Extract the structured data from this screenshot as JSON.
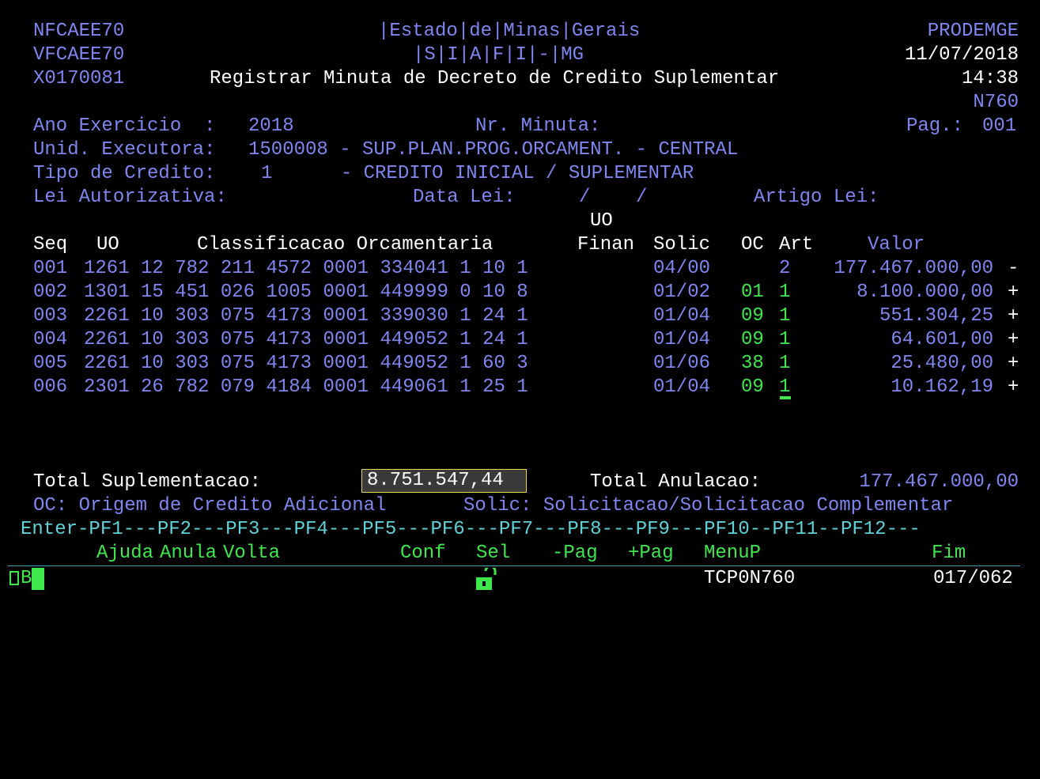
{
  "header": {
    "program_id": "NFCAEE70",
    "screen_id": "VFCAEE70",
    "transaction_id": "X0170081",
    "state_title": "|Estado|de|Minas|Gerais",
    "system_title": "|S|I|A|F|I|-|MG",
    "screen_title": "Registrar Minuta de Decreto de Credito Suplementar",
    "company": "PRODEMGE",
    "date": "11/07/2018",
    "time": "14:38",
    "screen_code": "N760"
  },
  "form": {
    "ano_label": "Ano Exercicio  :",
    "ano_value": "2018",
    "minuta_label": "Nr. Minuta:",
    "pag_label": "Pag.:",
    "pag_value": "001",
    "unid_label": "Unid. Executora:",
    "unid_value": "1500008 - SUP.PLAN.PROG.ORCAMENT. - CENTRAL",
    "tipo_label": "Tipo de Credito:",
    "tipo_value": "1      - CREDITO INICIAL / SUPLEMENTAR",
    "lei_label": "Lei Autorizativa:",
    "data_lei_label": "Data Lei:",
    "data_lei_value": "/    /",
    "artigo_label": "Artigo Lei:"
  },
  "table": {
    "headers": {
      "seq": "Seq",
      "uo": "UO",
      "classificacao": "Classificacao Orcamentaria",
      "uo_top": "UO",
      "finan": "Finan",
      "solic": "Solic",
      "oc": "OC",
      "art": "Art",
      "valor": "Valor"
    },
    "rows": [
      {
        "seq": "001",
        "classificacao": "1261 12 782 211 4572 0001 334041 1 10 1",
        "solic": "04/00",
        "oc": "",
        "art": "2",
        "valor": "177.467.000,00",
        "sign": "-"
      },
      {
        "seq": "002",
        "classificacao": "1301 15 451 026 1005 0001 449999 0 10 8",
        "solic": "01/02",
        "oc": "01",
        "art": "1",
        "valor": "8.100.000,00",
        "sign": "+"
      },
      {
        "seq": "003",
        "classificacao": "2261 10 303 075 4173 0001 339030 1 24 1",
        "solic": "01/04",
        "oc": "09",
        "art": "1",
        "valor": "551.304,25",
        "sign": "+"
      },
      {
        "seq": "004",
        "classificacao": "2261 10 303 075 4173 0001 449052 1 24 1",
        "solic": "01/04",
        "oc": "09",
        "art": "1",
        "valor": "64.601,00",
        "sign": "+"
      },
      {
        "seq": "005",
        "classificacao": "2261 10 303 075 4173 0001 449052 1 60 3",
        "solic": "01/06",
        "oc": "38",
        "art": "1",
        "valor": "25.480,00",
        "sign": "+"
      },
      {
        "seq": "006",
        "classificacao": "2301 26 782 079 4184 0001 449061 1 25 1",
        "solic": "01/04",
        "oc": "09",
        "art": "1",
        "valor": "10.162,19",
        "sign": "+"
      }
    ]
  },
  "totals": {
    "suplementacao_label": "Total Suplementacao:",
    "suplementacao_value": "8.751.547,44",
    "anulacao_label": "Total Anulacao:",
    "anulacao_value": "177.467.000,00"
  },
  "legend": {
    "oc": "OC: Origem de Credito Adicional",
    "solic": "Solic: Solicitacao/Solicitacao Complementar"
  },
  "function_keys": {
    "keys_line": "Enter-PF1---PF2---PF3---PF4---PF5---PF6---PF7---PF8---PF9---PF10--PF11--PF12---",
    "labels": {
      "pf1": "Ajuda",
      "pf2": "Anula",
      "pf3": "Volta",
      "pf5": "Conf",
      "pf6": "Sel",
      "pf7": "-Pag",
      "pf8": "+Pag",
      "pf9": "MenuP",
      "pf12": "Fim"
    }
  },
  "status_bar": {
    "session_letter": "B",
    "terminal_id": "TCP0N760",
    "cursor_pos": "017/062"
  },
  "colors": {
    "background": "#000000",
    "label": "#7f86f0",
    "value": "#ffffff",
    "highlight": "#3ee84c",
    "function_keys": "#5fd2d8",
    "field_border": "#e6d84a"
  }
}
